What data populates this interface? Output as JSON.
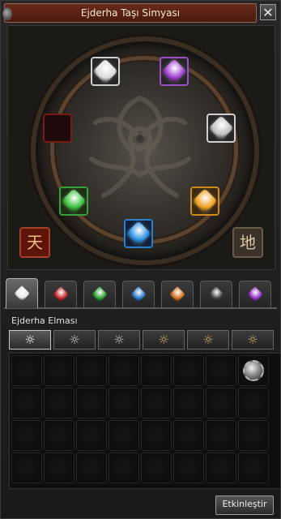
{
  "window": {
    "title": "Ejderha Taşı Simyası",
    "close_label": "✕"
  },
  "board": {
    "slots": [
      {
        "state": "stone",
        "color": "#dcdcdc"
      },
      {
        "state": "stone",
        "color": "#a040d0"
      },
      {
        "state": "stone",
        "color": "#c0c0c0"
      },
      {
        "state": "stone",
        "color": "#f0a020"
      },
      {
        "state": "stone",
        "color": "#2a90e0"
      },
      {
        "state": "stone",
        "color": "#3cc040"
      },
      {
        "state": "empty",
        "color": "#7a1a14"
      }
    ],
    "seal_heaven": "天",
    "seal_earth": "地"
  },
  "tabs": [
    {
      "icon": "white-stone-icon",
      "color": "#e8e8e8",
      "active": true
    },
    {
      "icon": "ruby-stone-icon",
      "color": "#c02828"
    },
    {
      "icon": "jade-stone-icon",
      "color": "#28a030"
    },
    {
      "icon": "sapphire-stone-icon",
      "color": "#2878c8"
    },
    {
      "icon": "garnet-stone-icon",
      "color": "#d07020"
    },
    {
      "icon": "onyx-stone-icon",
      "color": "#404040"
    },
    {
      "icon": "amethyst-stone-icon",
      "color": "#9030c0"
    }
  ],
  "category_label": "Ejderha Elması",
  "grades": [
    "☼",
    "☼",
    "☼",
    "☼",
    "☼",
    "☼"
  ],
  "inventory": {
    "columns": 8,
    "rows": 4,
    "items": [
      {
        "row": 0,
        "col": 7,
        "icon": "diamond-stone-icon"
      }
    ]
  },
  "activate_label": "Etkinleştir"
}
